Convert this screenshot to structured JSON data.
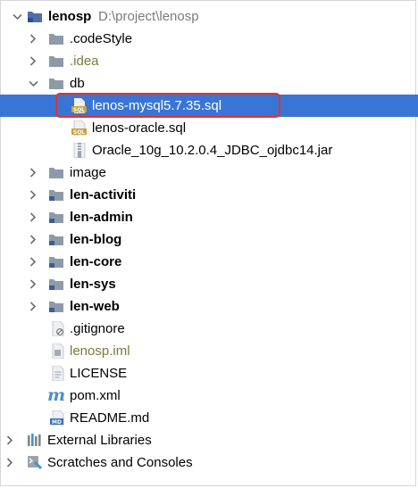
{
  "project": {
    "name": "lenosp",
    "path": "D:\\project\\lenosp"
  },
  "tree": {
    "codeStyle": ".codeStyle",
    "idea": ".idea",
    "db": "db",
    "db_files": {
      "mysql": "lenos-mysql5.7.35.sql",
      "oracle": "lenos-oracle.sql",
      "jar": "Oracle_10g_10.2.0.4_JDBC_ojdbc14.jar"
    },
    "image": "image",
    "modules": [
      "len-activiti",
      "len-admin",
      "len-blog",
      "len-core",
      "len-sys",
      "len-web"
    ],
    "files": {
      "gitignore": ".gitignore",
      "iml": "lenosp.iml",
      "license": "LICENSE",
      "pom": "pom.xml",
      "readme": "README.md"
    },
    "external_libraries": "External Libraries",
    "scratches": "Scratches and Consoles"
  },
  "icon_glyphs": {
    "maven": "m",
    "markdown_badge": "MD",
    "sql_badge": "SQL"
  },
  "colors": {
    "selection": "#3875d6",
    "highlight_box": "#e5322d",
    "folder": "#8d9aa8",
    "module_folder": "#4f6fa8",
    "idea_text": "#7a7a3a"
  }
}
